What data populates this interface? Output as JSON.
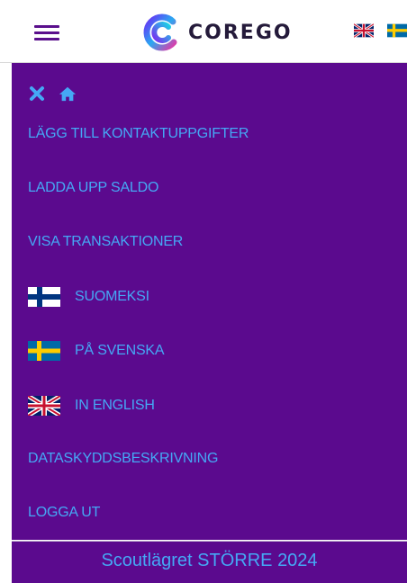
{
  "header": {
    "logo_text": "COREGO",
    "menu_icon": "hamburger-icon",
    "flags": [
      "uk-flag-icon",
      "sweden-flag-icon"
    ]
  },
  "menu": {
    "top_icons": [
      "close-icon",
      "home-icon"
    ],
    "items": [
      {
        "label": "LÄGG TILL KONTAKTUPPGIFTER"
      },
      {
        "label": "LADDA UPP SALDO"
      },
      {
        "label": "VISA TRANSAKTIONER"
      },
      {
        "label": "SUOMEKSI",
        "icon": "finland-flag-icon"
      },
      {
        "label": "PÅ SVENSKA",
        "icon": "sweden-flag-icon"
      },
      {
        "label": "IN ENGLISH",
        "icon": "uk-flag-icon"
      },
      {
        "label": "DATASKYDDSBESKRIVNING"
      },
      {
        "label": "LOGGA UT"
      }
    ]
  },
  "footer": {
    "text": "Scoutlägret STÖRRE 2024"
  },
  "colors": {
    "menu_bg": "#5b0a8e",
    "link": "#45a8f5",
    "brand_purple": "#5a0f8c"
  }
}
